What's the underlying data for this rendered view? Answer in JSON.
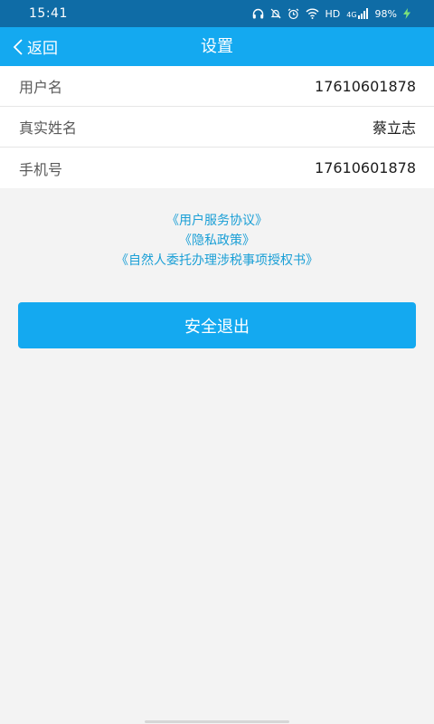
{
  "status_bar": {
    "time": "15:41",
    "network": "HD",
    "signal_label": "4G",
    "battery": "98%",
    "icons": [
      "headset-icon",
      "mute-bell-icon",
      "alarm-icon",
      "wifi-icon",
      "signal-icon",
      "charging-icon"
    ]
  },
  "nav": {
    "back_label": "返回",
    "title": "设置"
  },
  "info_rows": [
    {
      "label": "用户名",
      "value": "17610601878"
    },
    {
      "label": "真实姓名",
      "value": "蔡立志"
    },
    {
      "label": "手机号",
      "value": "17610601878"
    }
  ],
  "links": {
    "user_agreement": "《用户服务协议》",
    "privacy_policy": "《隐私政策》",
    "tax_authorization": "《自然人委托办理涉税事项授权书》"
  },
  "logout_label": "安全退出",
  "colors": {
    "status_bar": "#0f6ca6",
    "primary": "#14a9f0",
    "link": "#1a9fd6",
    "background": "#f3f3f3"
  }
}
